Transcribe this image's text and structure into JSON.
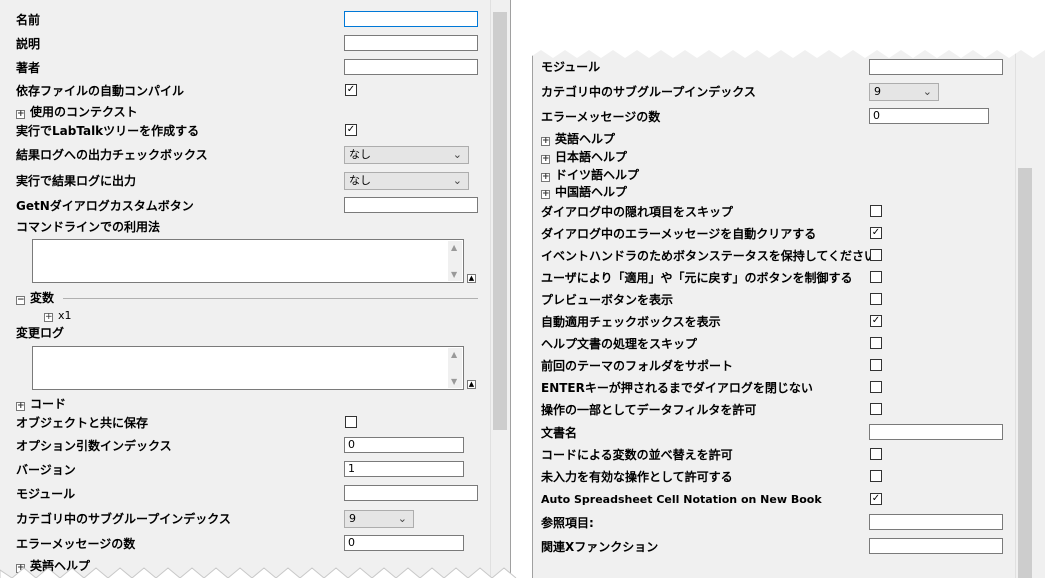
{
  "left": {
    "rows": [
      {
        "label": "名前",
        "control": "text",
        "value": "",
        "focused": true
      },
      {
        "label": "説明",
        "control": "text",
        "value": ""
      },
      {
        "label": "著者",
        "control": "text",
        "value": ""
      },
      {
        "label": "依存ファイルの自動コンパイル",
        "control": "checkbox",
        "checked": true
      },
      {
        "label": "使用のコンテクスト",
        "control": "expander"
      },
      {
        "label": "実行でLabTalkツリーを作成する",
        "control": "checkbox",
        "checked": true
      },
      {
        "label": "結果ログへの出力チェックボックス",
        "control": "dropdown",
        "value": "なし"
      },
      {
        "label": "実行で結果ログに出力",
        "control": "dropdown",
        "value": "なし"
      },
      {
        "label": "GetNダイアログカスタムボタン",
        "control": "text",
        "value": ""
      },
      {
        "label": "コマンドラインでの利用法",
        "control": "textarea",
        "value": ""
      },
      {
        "label": "変数",
        "control": "section",
        "child": "x1"
      },
      {
        "label": "変更ログ",
        "control": "textarea",
        "value": ""
      },
      {
        "label": "コード",
        "control": "expander"
      },
      {
        "label": "オブジェクトと共に保存",
        "control": "checkbox",
        "checked": false
      },
      {
        "label": "オプション引数インデックス",
        "control": "text",
        "value": "0"
      },
      {
        "label": "バージョン",
        "control": "text",
        "value": "1"
      },
      {
        "label": "モジュール",
        "control": "text",
        "value": ""
      },
      {
        "label": "カテゴリ中のサブグループインデックス",
        "control": "dropdown",
        "value": "9"
      },
      {
        "label": "エラーメッセージの数",
        "control": "text",
        "value": "0"
      },
      {
        "label": "英語ヘルプ",
        "control": "expander"
      }
    ]
  },
  "right": {
    "rows": [
      {
        "label": "モジュール",
        "control": "text",
        "value": ""
      },
      {
        "label": "カテゴリ中のサブグループインデックス",
        "control": "dropdown",
        "value": "9"
      },
      {
        "label": "エラーメッセージの数",
        "control": "text",
        "value": "0"
      },
      {
        "label": "英語ヘルプ",
        "control": "expander"
      },
      {
        "label": "日本語ヘルプ",
        "control": "expander"
      },
      {
        "label": "ドイツ語ヘルプ",
        "control": "expander"
      },
      {
        "label": "中国語ヘルプ",
        "control": "expander"
      },
      {
        "label": "ダイアログ中の隠れ項目をスキップ",
        "control": "checkbox",
        "checked": false
      },
      {
        "label": "ダイアログ中のエラーメッセージを自動クリアする",
        "control": "checkbox",
        "checked": true
      },
      {
        "label": "イベントハンドラのためボタンステータスを保持してください",
        "control": "checkbox",
        "checked": false
      },
      {
        "label": "ユーザにより「適用」や「元に戻す」のボタンを制御する",
        "control": "checkbox",
        "checked": false
      },
      {
        "label": "プレビューボタンを表示",
        "control": "checkbox",
        "checked": false
      },
      {
        "label": "自動適用チェックボックスを表示",
        "control": "checkbox",
        "checked": true
      },
      {
        "label": "ヘルプ文書の処理をスキップ",
        "control": "checkbox",
        "checked": false
      },
      {
        "label": "前回のテーマのフォルダをサポート",
        "control": "checkbox",
        "checked": false
      },
      {
        "label": "ENTERキーが押されるまでダイアログを閉じない",
        "control": "checkbox",
        "checked": false
      },
      {
        "label": "操作の一部としてデータフィルタを許可",
        "control": "checkbox",
        "checked": false
      },
      {
        "label": "文書名",
        "control": "text",
        "value": ""
      },
      {
        "label": "コードによる変数の並べ替えを許可",
        "control": "checkbox",
        "checked": false
      },
      {
        "label": "未入力を有効な操作として許可する",
        "control": "checkbox",
        "checked": false
      },
      {
        "label": "Auto Spreadsheet Cell Notation on New Book",
        "control": "checkbox",
        "checked": true
      },
      {
        "label": "参照項目:",
        "control": "text",
        "value": ""
      },
      {
        "label": "関連Xファンクション",
        "control": "text",
        "value": ""
      }
    ]
  },
  "icons": {
    "check": "✓",
    "expand": "+",
    "collapse": "−",
    "dropdown": "⌄"
  }
}
